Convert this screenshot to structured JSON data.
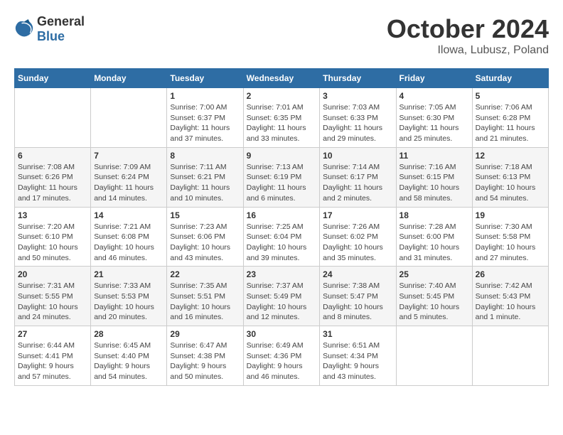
{
  "header": {
    "logo_general": "General",
    "logo_blue": "Blue",
    "month": "October 2024",
    "location": "Ilowa, Lubusz, Poland"
  },
  "weekdays": [
    "Sunday",
    "Monday",
    "Tuesday",
    "Wednesday",
    "Thursday",
    "Friday",
    "Saturday"
  ],
  "weeks": [
    [
      {
        "day": "",
        "details": ""
      },
      {
        "day": "",
        "details": ""
      },
      {
        "day": "1",
        "details": "Sunrise: 7:00 AM\nSunset: 6:37 PM\nDaylight: 11 hours\nand 37 minutes."
      },
      {
        "day": "2",
        "details": "Sunrise: 7:01 AM\nSunset: 6:35 PM\nDaylight: 11 hours\nand 33 minutes."
      },
      {
        "day": "3",
        "details": "Sunrise: 7:03 AM\nSunset: 6:33 PM\nDaylight: 11 hours\nand 29 minutes."
      },
      {
        "day": "4",
        "details": "Sunrise: 7:05 AM\nSunset: 6:30 PM\nDaylight: 11 hours\nand 25 minutes."
      },
      {
        "day": "5",
        "details": "Sunrise: 7:06 AM\nSunset: 6:28 PM\nDaylight: 11 hours\nand 21 minutes."
      }
    ],
    [
      {
        "day": "6",
        "details": "Sunrise: 7:08 AM\nSunset: 6:26 PM\nDaylight: 11 hours\nand 17 minutes."
      },
      {
        "day": "7",
        "details": "Sunrise: 7:09 AM\nSunset: 6:24 PM\nDaylight: 11 hours\nand 14 minutes."
      },
      {
        "day": "8",
        "details": "Sunrise: 7:11 AM\nSunset: 6:21 PM\nDaylight: 11 hours\nand 10 minutes."
      },
      {
        "day": "9",
        "details": "Sunrise: 7:13 AM\nSunset: 6:19 PM\nDaylight: 11 hours\nand 6 minutes."
      },
      {
        "day": "10",
        "details": "Sunrise: 7:14 AM\nSunset: 6:17 PM\nDaylight: 11 hours\nand 2 minutes."
      },
      {
        "day": "11",
        "details": "Sunrise: 7:16 AM\nSunset: 6:15 PM\nDaylight: 10 hours\nand 58 minutes."
      },
      {
        "day": "12",
        "details": "Sunrise: 7:18 AM\nSunset: 6:13 PM\nDaylight: 10 hours\nand 54 minutes."
      }
    ],
    [
      {
        "day": "13",
        "details": "Sunrise: 7:20 AM\nSunset: 6:10 PM\nDaylight: 10 hours\nand 50 minutes."
      },
      {
        "day": "14",
        "details": "Sunrise: 7:21 AM\nSunset: 6:08 PM\nDaylight: 10 hours\nand 46 minutes."
      },
      {
        "day": "15",
        "details": "Sunrise: 7:23 AM\nSunset: 6:06 PM\nDaylight: 10 hours\nand 43 minutes."
      },
      {
        "day": "16",
        "details": "Sunrise: 7:25 AM\nSunset: 6:04 PM\nDaylight: 10 hours\nand 39 minutes."
      },
      {
        "day": "17",
        "details": "Sunrise: 7:26 AM\nSunset: 6:02 PM\nDaylight: 10 hours\nand 35 minutes."
      },
      {
        "day": "18",
        "details": "Sunrise: 7:28 AM\nSunset: 6:00 PM\nDaylight: 10 hours\nand 31 minutes."
      },
      {
        "day": "19",
        "details": "Sunrise: 7:30 AM\nSunset: 5:58 PM\nDaylight: 10 hours\nand 27 minutes."
      }
    ],
    [
      {
        "day": "20",
        "details": "Sunrise: 7:31 AM\nSunset: 5:55 PM\nDaylight: 10 hours\nand 24 minutes."
      },
      {
        "day": "21",
        "details": "Sunrise: 7:33 AM\nSunset: 5:53 PM\nDaylight: 10 hours\nand 20 minutes."
      },
      {
        "day": "22",
        "details": "Sunrise: 7:35 AM\nSunset: 5:51 PM\nDaylight: 10 hours\nand 16 minutes."
      },
      {
        "day": "23",
        "details": "Sunrise: 7:37 AM\nSunset: 5:49 PM\nDaylight: 10 hours\nand 12 minutes."
      },
      {
        "day": "24",
        "details": "Sunrise: 7:38 AM\nSunset: 5:47 PM\nDaylight: 10 hours\nand 8 minutes."
      },
      {
        "day": "25",
        "details": "Sunrise: 7:40 AM\nSunset: 5:45 PM\nDaylight: 10 hours\nand 5 minutes."
      },
      {
        "day": "26",
        "details": "Sunrise: 7:42 AM\nSunset: 5:43 PM\nDaylight: 10 hours\nand 1 minute."
      }
    ],
    [
      {
        "day": "27",
        "details": "Sunrise: 6:44 AM\nSunset: 4:41 PM\nDaylight: 9 hours\nand 57 minutes."
      },
      {
        "day": "28",
        "details": "Sunrise: 6:45 AM\nSunset: 4:40 PM\nDaylight: 9 hours\nand 54 minutes."
      },
      {
        "day": "29",
        "details": "Sunrise: 6:47 AM\nSunset: 4:38 PM\nDaylight: 9 hours\nand 50 minutes."
      },
      {
        "day": "30",
        "details": "Sunrise: 6:49 AM\nSunset: 4:36 PM\nDaylight: 9 hours\nand 46 minutes."
      },
      {
        "day": "31",
        "details": "Sunrise: 6:51 AM\nSunset: 4:34 PM\nDaylight: 9 hours\nand 43 minutes."
      },
      {
        "day": "",
        "details": ""
      },
      {
        "day": "",
        "details": ""
      }
    ]
  ]
}
